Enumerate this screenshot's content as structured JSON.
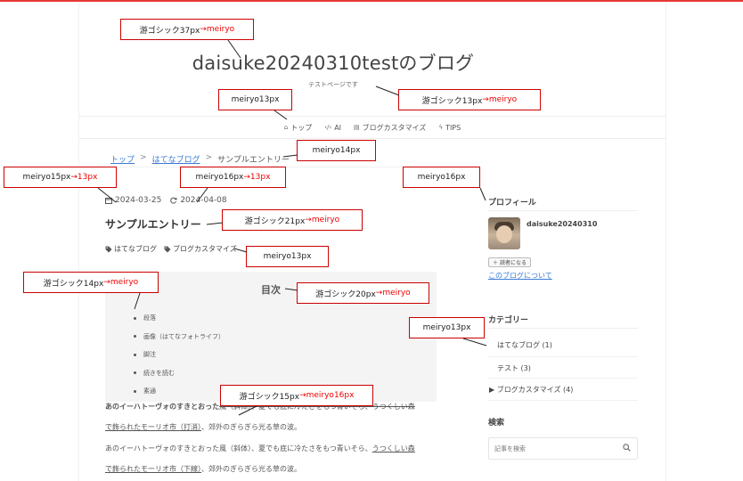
{
  "blog": {
    "title": "daisuke20240310testのブログ",
    "description": "テストページです"
  },
  "nav": [
    {
      "icon": "home-icon",
      "glyph": "⌂",
      "label": "トップ"
    },
    {
      "icon": "code-icon",
      "glyph": "‹/›",
      "label": "AI"
    },
    {
      "icon": "document-icon",
      "glyph": "▤",
      "label": "ブログカスタマイズ"
    },
    {
      "icon": "lightning-icon",
      "glyph": "ϟ",
      "label": "TIPS"
    }
  ],
  "breadcrumb": {
    "home": "トップ",
    "category": "はてなブログ",
    "current": "サンプルエントリー",
    "sep": ">"
  },
  "entry": {
    "posted": "2024-03-25",
    "updated": "2024-04-08",
    "title": "サンプルエントリー",
    "tags": [
      "はてなブログ",
      "ブログカスタマイズ"
    ]
  },
  "toc": {
    "title": "目次",
    "items": [
      "段落",
      "画像（はてなフォトライフ）",
      "脚注",
      "続きを読む",
      "素通"
    ]
  },
  "paragraph": {
    "lead": "あのイーハトーヴォのすきとおった",
    "line1_rest": "風（斜体）、夏でも底に冷たさをもつ青いそら、",
    "line1_link": "うつくしい森",
    "line2_link": "で飾られたモーリオ市（下線）",
    "line2_rest": "、郊外のぎらぎら光る草の波。",
    "p1_tail_link": "で飾られたモーリオ市（打消）",
    "p1_tail_rest": "、郊外のぎらぎら光る草の波。"
  },
  "sidebar": {
    "profile_heading": "プロフィール",
    "profile_name": "daisuke20240310",
    "reader_button": "読者になる",
    "about_link": "このブログについて",
    "category_heading": "カテゴリー",
    "categories": [
      "はてなブログ (1)",
      "テスト (3)",
      "▶ ブログカスタマイズ (4)"
    ],
    "search_heading": "検索",
    "search_placeholder": "記事を検索"
  },
  "annotations": [
    {
      "black": "游ゴシック37px",
      "red": "→meiryo"
    },
    {
      "black": "meiryo13px",
      "red": ""
    },
    {
      "black": "游ゴシック13px",
      "red": "→meiryo"
    },
    {
      "black": "meiryo14px",
      "red": ""
    },
    {
      "black": "meiryo15px",
      "red": "→13px"
    },
    {
      "black": "meiryo16px",
      "red": "→13px"
    },
    {
      "black": "meiryo16px",
      "red": ""
    },
    {
      "black": "游ゴシック21px",
      "red": "→meiryo"
    },
    {
      "black": "meiryo13px",
      "red": ""
    },
    {
      "black": "游ゴシック14px",
      "red": "→meiryo"
    },
    {
      "black": "游ゴシック20px",
      "red": "→meiryo"
    },
    {
      "black": "meiryo13px",
      "red": ""
    },
    {
      "black": "游ゴシック15px",
      "red": "→meiryo16px"
    }
  ],
  "colors": {
    "accent_bar": "#e53935",
    "link": "#3a7bd5",
    "annotation_border": "#cc0000",
    "annotation_red": "#ee0000"
  }
}
